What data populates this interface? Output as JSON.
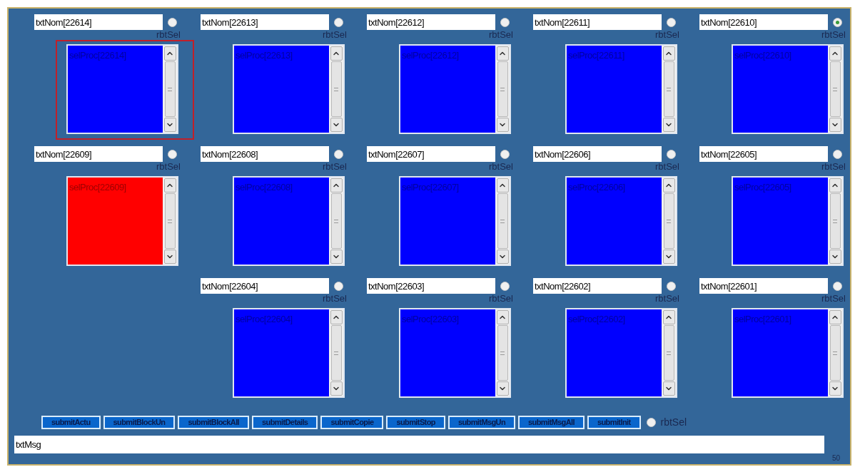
{
  "rows": [
    {
      "cells": [
        {
          "name": "txtNom[22614]",
          "radio_selected": false,
          "radio_label": "rbtSel",
          "list_label": "selProc[22614]",
          "color": "#0000ff",
          "focused": true
        },
        {
          "name": "txtNom[22613]",
          "radio_selected": false,
          "radio_label": "rbtSel",
          "list_label": "selProc[22613]",
          "color": "#0000ff",
          "focused": false
        },
        {
          "name": "txtNom[22612]",
          "radio_selected": false,
          "radio_label": "rbtSel",
          "list_label": "selProc[22612]",
          "color": "#0000ff",
          "focused": false
        },
        {
          "name": "txtNom[22611]",
          "radio_selected": false,
          "radio_label": "rbtSel",
          "list_label": "selProc[22611]",
          "color": "#0000ff",
          "focused": false
        },
        {
          "name": "txtNom[22610]",
          "radio_selected": true,
          "radio_label": "rbtSel",
          "list_label": "selProc[22610]",
          "color": "#0000ff",
          "focused": false
        }
      ]
    },
    {
      "cells": [
        {
          "name": "txtNom[22609]",
          "radio_selected": false,
          "radio_label": "rbtSel",
          "list_label": "selProc[22609]",
          "color": "#ff0000",
          "focused": false
        },
        {
          "name": "txtNom[22608]",
          "radio_selected": false,
          "radio_label": "rbtSel",
          "list_label": "selProc[22608]",
          "color": "#0000ff",
          "focused": false
        },
        {
          "name": "txtNom[22607]",
          "radio_selected": false,
          "radio_label": "rbtSel",
          "list_label": "selProc[22607]",
          "color": "#0000ff",
          "focused": false
        },
        {
          "name": "txtNom[22606]",
          "radio_selected": false,
          "radio_label": "rbtSel",
          "list_label": "selProc[22606]",
          "color": "#0000ff",
          "focused": false
        },
        {
          "name": "txtNom[22605]",
          "radio_selected": false,
          "radio_label": "rbtSel",
          "list_label": "selProc[22605]",
          "color": "#0000ff",
          "focused": false
        }
      ]
    },
    {
      "cells": [
        {
          "name": "txtNom[22604]",
          "radio_selected": false,
          "radio_label": "rbtSel",
          "list_label": "selProc[22604]",
          "color": "#0000ff",
          "focused": false
        },
        {
          "name": "txtNom[22603]",
          "radio_selected": false,
          "radio_label": "rbtSel",
          "list_label": "selProc[22603]",
          "color": "#0000ff",
          "focused": false
        },
        {
          "name": "txtNom[22602]",
          "radio_selected": false,
          "radio_label": "rbtSel",
          "list_label": "selProc[22602]",
          "color": "#0000ff",
          "focused": false
        },
        {
          "name": "txtNom[22601]",
          "radio_selected": false,
          "radio_label": "rbtSel",
          "list_label": "selProc[22601]",
          "color": "#0000ff",
          "focused": false
        }
      ]
    }
  ],
  "buttons": [
    "submitActu",
    "submitBlockUn",
    "submitBlockAll",
    "submitDetails",
    "submitCopie",
    "submitStop",
    "submitMsgUn",
    "submitMsgAll",
    "submitInit"
  ],
  "bottom_radio": {
    "label": "rbtSel",
    "selected": false
  },
  "message_field": {
    "value": "txtMsg"
  },
  "counter": "50"
}
